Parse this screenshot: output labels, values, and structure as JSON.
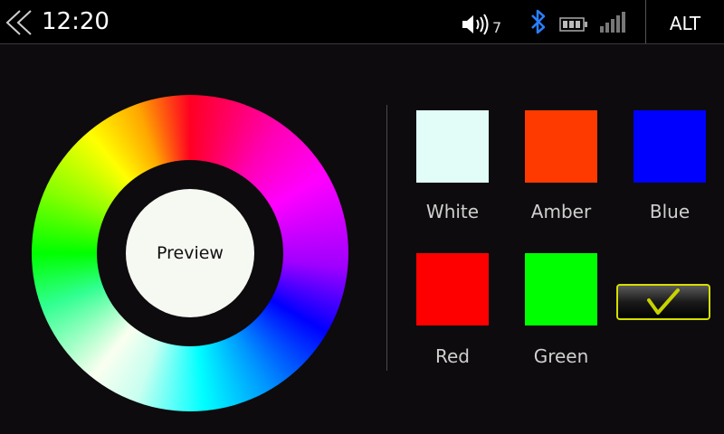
{
  "status_bar": {
    "time": "12:20",
    "volume_level": "7",
    "icons": [
      "back-chevron-icon",
      "speaker-icon",
      "bluetooth-icon",
      "battery-icon",
      "signal-icon"
    ],
    "alt_label": "ALT"
  },
  "color_wheel": {
    "preview_label": "Preview",
    "preview_color": "#f6f8f2"
  },
  "swatches": [
    {
      "label": "White",
      "color": "#e2fcf7"
    },
    {
      "label": "Amber",
      "color": "#ff3a00"
    },
    {
      "label": "Blue",
      "color": "#0000ff"
    },
    {
      "label": "Red",
      "color": "#ff0000"
    },
    {
      "label": "Green",
      "color": "#00ff00"
    }
  ],
  "confirm": {
    "icon": "checkmark-icon",
    "border_color": "#d4df00",
    "check_color": "#c8d200"
  },
  "colors": {
    "background": "#0d0b0d",
    "topbar": "#000000",
    "bluetooth": "#2a7fff"
  }
}
